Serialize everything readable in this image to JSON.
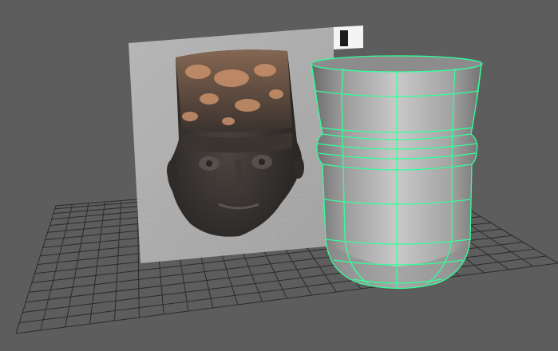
{
  "viewport": {
    "background_color": "#5d5d5d",
    "grid_color": "#2b2b2b",
    "wireframe_color": "#33ff9a",
    "model_shade": "#b8b8b8",
    "image_plane_tint": "#d4d4d4"
  },
  "objects": {
    "reference_image": "photo-of-ceramic-head-vessel",
    "model": "vessel-mesh-with-wireframe"
  }
}
